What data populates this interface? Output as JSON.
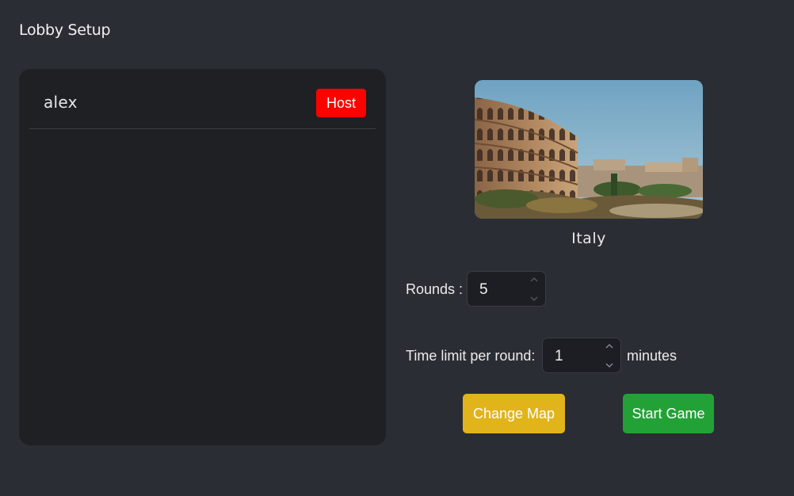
{
  "header": {
    "title": "Lobby Setup"
  },
  "players": [
    {
      "name": "alex",
      "badge": "Host",
      "badge_color": "#ff0000"
    }
  ],
  "map": {
    "name": "Italy",
    "image": "colosseum-rome-photo"
  },
  "settings": {
    "rounds_label": "Rounds :",
    "rounds_value": "5",
    "time_label": "Time limit per round:",
    "time_value": "1",
    "time_unit": "minutes"
  },
  "buttons": {
    "change_map": "Change Map",
    "change_map_color": "#e1b41b",
    "start_game": "Start Game",
    "start_game_color": "#22a236"
  }
}
